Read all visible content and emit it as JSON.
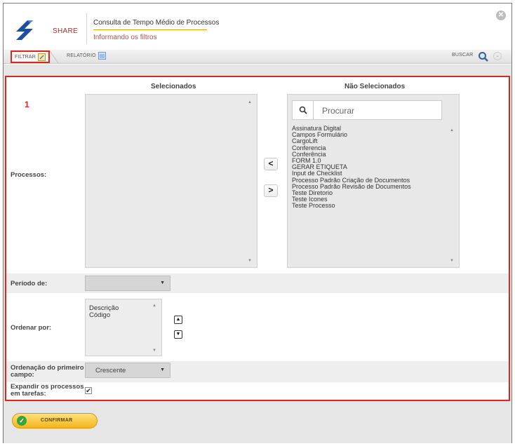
{
  "app": {
    "brand": "SHARE",
    "title": "Consulta de Tempo Médio de Processos",
    "subtitle": "Informando os filtros"
  },
  "toolbar": {
    "tab_filtrar": "FILTRAR",
    "tab_relatorio": "RELATÓRIO",
    "buscar": "BUSCAR"
  },
  "form": {
    "marker": "1",
    "selecionados_header": "Selecionados",
    "nao_selecionados_header": "Não Selecionados",
    "search_placeholder": "Procurar",
    "move_left": "<",
    "move_right": ">",
    "processos_label": "Processos:",
    "periodo_label": "Período de:",
    "periodo_value": "",
    "ordenar_label": "Ordenar por:",
    "ordenar_options": [
      "Descrição",
      "Código"
    ],
    "ordenacao_label_1": "Ordenação do primeiro",
    "ordenacao_label_2": "campo:",
    "ordenacao_value": "Crescente",
    "expandir_label_1": "Expandir os processos",
    "expandir_label_2": "em tarefas:",
    "expandir_checked": true,
    "nao_selecionados_items": [
      "Assinatura Digital",
      "Campos Formulário",
      "CargoLift",
      "Conferencia",
      "Conferência",
      "FORM 1.0",
      "GERAR ETIQUETA",
      "Input de Checklist",
      "Processo Padrão Criação de Documentos",
      "Processo Padrão Revisão de Documentos",
      "Teste Diretorio",
      "Teste Icones",
      "Teste Processo"
    ]
  },
  "footer": {
    "confirm_label": "CONFIRMAR"
  },
  "colors": {
    "accent_red": "#e1241e",
    "brand_red": "#a0312d",
    "confirm_yellow": "#f2b51c",
    "confirm_green": "#3aa43a"
  }
}
